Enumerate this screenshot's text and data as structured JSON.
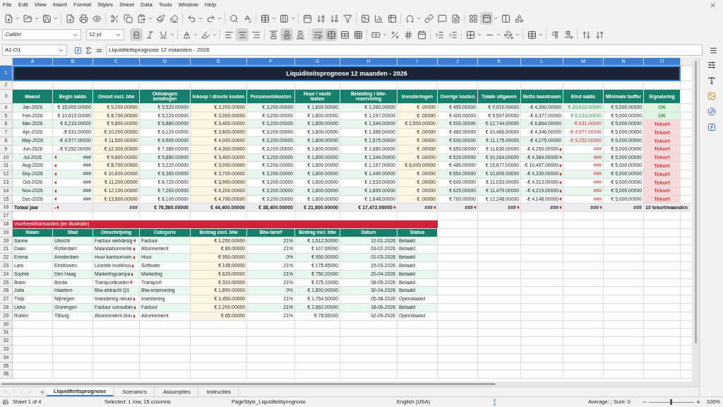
{
  "menu": [
    "File",
    "Edit",
    "View",
    "Insert",
    "Format",
    "Styles",
    "Sheet",
    "Data",
    "Tools",
    "Window",
    "Help"
  ],
  "format_toolbar": {
    "font_name": "Calibri",
    "font_size": "12 pt",
    "bold": true,
    "italic": false,
    "underline": false,
    "align_left": false,
    "align_center": true,
    "align_right": false,
    "align_top": false,
    "align_middle": true,
    "align_bottom": false,
    "wrap": true,
    "merge": true
  },
  "formula_bar": {
    "name_box": "A1:O1",
    "content": "Liquiditeitsprognose 12 maanden - 2026"
  },
  "columns": [
    {
      "label": "A",
      "selected": true
    },
    {
      "label": "B",
      "selected": true
    },
    {
      "label": "C",
      "selected": true
    },
    {
      "label": "D",
      "selected": true
    },
    {
      "label": "E",
      "selected": true
    },
    {
      "label": "F",
      "selected": true
    },
    {
      "label": "G",
      "selected": true
    },
    {
      "label": "H",
      "selected": true
    },
    {
      "label": "I",
      "selected": true
    },
    {
      "label": "J",
      "selected": true
    },
    {
      "label": "K",
      "selected": true
    },
    {
      "label": "L",
      "selected": true
    },
    {
      "label": "M",
      "selected": true
    },
    {
      "label": "N",
      "selected": true
    },
    {
      "label": "O",
      "selected": true
    }
  ],
  "rows": [
    {
      "kind": "title",
      "num": "1",
      "selected": true,
      "text": "Liquiditeitsprognose 12 maanden - 2026"
    },
    {
      "kind": "blank",
      "num": "2"
    },
    {
      "kind": "header",
      "num": "3",
      "cells": [
        "Maand",
        "Begin saldo",
        "Omzet excl. btw",
        "Ontvangen betalingen",
        "Inkoop / directe kosten",
        "Personeelskosten",
        "Huur / vaste lasten",
        "Belasting / btw-reservering",
        "Investeringen",
        "Overige kosten",
        "Totale uitgaven",
        "Netto kasstroom",
        "Eind saldo",
        "Minimale buffer",
        "Signalering"
      ]
    },
    {
      "kind": "data",
      "num": "4",
      "alert": false,
      "cells": [
        "Jan-2026",
        "€ 15,000.00000",
        "€ 9,200.00000",
        "€ 5,520.00000",
        "€ 3,200.00000",
        "€ 3,200.00000",
        "€ 1,800.00000",
        "€ 1,260.00000",
        "€ .00000",
        "€ 450.00000",
        "€ 9,910.00000",
        "-€ 4,390.00000",
        "€ 10,610.00000",
        "€ 5,000.00000",
        "OK"
      ]
    },
    {
      "kind": "data",
      "num": "5",
      "alert": false,
      "cells": [
        "Feb-2026",
        "€ 10,610.00000",
        "€ 8,700.00000",
        "€ 5,220.00000",
        "€ 3,000.00000",
        "€ 3,200.00000",
        "€ 1,800.00000",
        "€ 1,197.00000",
        "€ .00000",
        "€ 400.00000",
        "€ 9,597.00000",
        "-€ 4,377.00000",
        "€ 6,233.00000",
        "€ 5,000.00000",
        "OK"
      ]
    },
    {
      "kind": "data",
      "num": "6",
      "alert": true,
      "cells": [
        "Mar-2026",
        "€ 6,233.00000",
        "€ 9,800.00000",
        "€ 5,880.00000",
        "€ 3,400.00000",
        "€ 3,200.00000",
        "€ 1,800.00000",
        "€ 1,344.00000",
        "€ 2,500.00000",
        "€ 500.00000",
        "€ 12,744.00000",
        "-€ 6,864.00000",
        "-€ 631.00000",
        "€ 5,000.00000",
        "Tekort"
      ]
    },
    {
      "kind": "data",
      "num": "7",
      "alert": true,
      "cells": [
        "Apr-2026",
        "-€ 631.00000",
        "€ 10,200.00000",
        "€ 6,120.00000",
        "€ 3,600.00000",
        "€ 3,200.00000",
        "€ 1,800.00000",
        "€ 1,386.00000",
        "€ .00000",
        "€ 480.00000",
        "€ 10,466.00000",
        "-€ 4,346.00000",
        "-€ 4,977.00000",
        "€ 5,000.00000",
        "Tekort"
      ]
    },
    {
      "kind": "data",
      "num": "8",
      "alert": true,
      "cells": [
        "May-2026",
        "-€ 4,977.00000",
        "€ 11,500.00000",
        "€ 6,900.00000",
        "€ 4,000.00000",
        "€ 3,200.00000",
        "€ 1,800.00000",
        "€ 1,575.00000",
        "€ .00000",
        "€ 600.00000",
        "€ 11,175.00000",
        "-€ 4,275.00000",
        "-€ 9,252.00000",
        "€ 5,000.00000",
        "Tekort"
      ]
    },
    {
      "kind": "data",
      "num": "9",
      "alert": true,
      "cells": [
        "Jun-2026",
        "-€ 9,252.00000",
        "€ 12,300.00000",
        "€ 7,380.00000",
        "€ 4,300.00000",
        "€ 3,200.00000",
        "€ 1,800.00000",
        "€ 1,680.00000",
        "€ .00000",
        "€ 650.00000",
        "€ 11,630.00000",
        {
          "text": "-€ 4,250.00000",
          "clipped": true
        },
        "###",
        "€ 5,000.00000",
        "Tekort"
      ]
    },
    {
      "kind": "data",
      "num": "10",
      "alert": true,
      "cells": [
        "Jul-2026",
        {
          "text": "###",
          "clipped": true
        },
        "€ 9,800.00000",
        "€ 5,880.00000",
        "€ 3,400.00000",
        "€ 3,200.00000",
        "€ 1,800.00000",
        "€ 1,344.00000",
        "€ .00000",
        "€ 520.00000",
        "€ 10,264.00000",
        {
          "text": "-€ 4,384.00000",
          "clipped": true
        },
        "###",
        "€ 5,000.00000",
        "Tekort"
      ]
    },
    {
      "kind": "data",
      "num": "11",
      "alert": true,
      "cells": [
        "Aug-2026",
        {
          "text": "###",
          "clipped": true
        },
        "€ 8,700.00000",
        "€ 5,220.00000",
        "€ 3,000.00000",
        "€ 3,200.00000",
        "€ 1,800.00000",
        "€ 1,197.00000",
        "€ 6,000.00000",
        "€ 480.00000",
        "€ 15,677.00000",
        {
          "text": "-€ 10,457.00000",
          "clipped": true
        },
        "###",
        "€ 5,000.00000",
        "Tekort"
      ]
    },
    {
      "kind": "data",
      "num": "12",
      "alert": true,
      "cells": [
        "Sep-2026",
        {
          "text": "###",
          "clipped": true
        },
        "€ 10,600.00000",
        "€ 6,360.00000",
        "€ 3,700.00000",
        "€ 3,200.00000",
        "€ 1,800.00000",
        "€ 1,449.00000",
        "€ .00000",
        "€ 550.00000",
        "€ 10,699.00000",
        {
          "text": "-€ 4,339.00000",
          "clipped": true
        },
        "###",
        "€ 5,000.00000",
        "Tekort"
      ]
    },
    {
      "kind": "data",
      "num": "13",
      "alert": true,
      "cells": [
        "Oct-2026",
        {
          "text": "###",
          "clipped": true
        },
        "€ 11,200.00000",
        "€ 6,720.00000",
        "€ 3,900.00000",
        "€ 3,200.00000",
        "€ 1,800.00000",
        "€ 1,533.00000",
        "€ .00000",
        "€ 600.00000",
        "€ 11,033.00000",
        {
          "text": "-€ 4,313.00000",
          "clipped": true
        },
        "###",
        "€ 5,000.00000",
        "Tekort"
      ]
    },
    {
      "kind": "data",
      "num": "14",
      "alert": true,
      "cells": [
        "Nov-2026",
        {
          "text": "###",
          "clipped": true
        },
        "€ 12,100.00000",
        "€ 7,260.00000",
        "€ 4,200.00000",
        "€ 3,200.00000",
        "€ 1,800.00000",
        "€ 1,659.00000",
        "€ .00000",
        "€ 620.00000",
        "€ 11,479.00000",
        {
          "text": "-€ 4,219.00000",
          "clipped": true
        },
        "###",
        "€ 5,000.00000",
        "Tekort"
      ]
    },
    {
      "kind": "data",
      "num": "15",
      "alert": true,
      "cells": [
        "Dec-2026",
        {
          "text": "###",
          "clipped": true
        },
        "€ 13,500.00000",
        "€ 8,100.00000",
        "€ 4,700.00000",
        "€ 3,200.00000",
        "€ 1,800.00000",
        "€ 1,848.00000",
        "€ .00000",
        "€ 700.00000",
        "€ 12,248.00000",
        {
          "text": "-€ 4,148.00000",
          "clipped": true
        },
        "###",
        "€ 5,000.00000",
        "Tekort"
      ]
    },
    {
      "kind": "total",
      "num": "16",
      "cells": [
        "Totaal jaar",
        {
          "text": "-",
          "clipped": true
        },
        "###",
        "€ 76,560.00000",
        "€ 44,400.00000",
        "€ 38,400.00000",
        "€ 21,600.00000",
        {
          "text": "€ 17,472.00000",
          "clipped": true
        },
        {
          "text": "###",
          "clipped": true
        },
        {
          "text": "###",
          "clipped": true
        },
        {
          "text": "###",
          "clipped": true
        },
        {
          "text": "###",
          "clipped": true
        },
        {
          "text": "###",
          "clipped": true
        },
        "###",
        "10 tekortmaanden"
      ]
    },
    {
      "kind": "blank",
      "num": "17"
    },
    {
      "kind": "banner",
      "num": "18",
      "text": "Voorbeeldtransacties (ter illustratie)"
    },
    {
      "kind": "tx_header",
      "num": "19",
      "cells": [
        "Naam",
        "Stad",
        "Omschrijving",
        "Categorie",
        "Bedrag excl. btw",
        "Btw-tarief",
        "Bedrag incl. btw",
        "Datum",
        "Status"
      ]
    },
    {
      "kind": "tx",
      "num": "20",
      "cells": [
        "Sanne",
        "Utrecht",
        {
          "text": "Factuur webdesig",
          "clipped": true
        },
        "Factuur",
        "€ 1,250.00000",
        "21%",
        "€ 1,512.50000",
        "12-01-2026",
        "Betaald"
      ]
    },
    {
      "kind": "tx",
      "num": "21",
      "cells": [
        "Daan",
        "Rotterdam",
        {
          "text": "Maandabonneme",
          "clipped": true
        },
        "Abonnement",
        "€ 89.00000",
        "21%",
        "€ 107.69000",
        "03-02-2026",
        "Betaald"
      ]
    },
    {
      "kind": "tx",
      "num": "22",
      "cells": [
        "Emma",
        "Amsterdam",
        {
          "text": "Huur kantoorruim",
          "clipped": true
        },
        "Huur",
        "€ 950.00000",
        "0%",
        "€ 950.00000",
        "01-03-2026",
        "Betaald"
      ]
    },
    {
      "kind": "tx",
      "num": "23",
      "cells": [
        "Lars",
        "Eindhoven",
        {
          "text": "Licentie boekhou",
          "clipped": true
        },
        "Software",
        "€ 145.00000",
        "21%",
        "€ 175.45000",
        "15-03-2026",
        "Betaald"
      ]
    },
    {
      "kind": "tx",
      "num": "24",
      "cells": [
        "Sophie",
        "Den Haag",
        {
          "text": "Marketingcampa",
          "clipped": true
        },
        "Marketing",
        "€ 620.00000",
        "21%",
        "€ 750.20000",
        "20-04-2026",
        "Betaald"
      ]
    },
    {
      "kind": "tx",
      "num": "25",
      "cells": [
        "Bram",
        "Breda",
        {
          "text": "Transportkosten",
          "clipped": true
        },
        "Transport",
        "€ 310.00000",
        "21%",
        "€ 375.10000",
        "08-05-2026",
        "Betaald"
      ]
    },
    {
      "kind": "tx",
      "num": "26",
      "cells": [
        "Julia",
        "Haarlem",
        "Btw-afdracht Q1",
        "Btw-reservering",
        "€ 1,890.00000",
        "0%",
        "€ 1,890.00000",
        "30-04-2026",
        "Betaald"
      ]
    },
    {
      "kind": "tx",
      "num": "27",
      "cells": [
        "Thijs",
        "Nijmegen",
        {
          "text": "Investering nieuw",
          "clipped": true
        },
        "Investering",
        "€ 1,450.00000",
        "21%",
        "€ 1,754.50000",
        "05-08-2026",
        "Openstaand"
      ]
    },
    {
      "kind": "tx",
      "num": "28",
      "cells": [
        "Lieke",
        "Groningen",
        {
          "text": "Factuur consultan",
          "clipped": true
        },
        "Factuur",
        "€ 2,200.00000",
        "21%",
        "€ 2,662.00000",
        "18-06-2026",
        "Betaald"
      ]
    },
    {
      "kind": "tx",
      "num": "29",
      "cells": [
        "Ruben",
        "Tilburg",
        {
          "text": "Abonnement clou",
          "clipped": true
        },
        "Abonnement",
        "€ 65.00000",
        "21%",
        "€ 78.65000",
        "02-09-2026",
        "Openstaand"
      ]
    },
    {
      "kind": "blank",
      "num": "30"
    },
    {
      "kind": "blank",
      "num": "31"
    },
    {
      "kind": "blank",
      "num": "32"
    },
    {
      "kind": "blank",
      "num": "33"
    },
    {
      "kind": "blank",
      "num": "34"
    },
    {
      "kind": "blank",
      "num": "35"
    },
    {
      "kind": "blank",
      "num": "36"
    }
  ],
  "sheet_tabs": [
    {
      "label": "Liquiditeitsprognose",
      "selected": true
    },
    {
      "label": "Scenario's",
      "selected": false
    },
    {
      "label": "Assumpties",
      "selected": false
    },
    {
      "label": "Instructies",
      "selected": false
    }
  ],
  "status_bar": {
    "sheet": "Sheet 1 of 4",
    "selection": "Selected: 1 row, 15 columns",
    "page_style": "PageStyle_Liquiditeitsprognose",
    "language": "English (USA)",
    "summary": "Average: ; Sum: 0",
    "zoom": {
      "level": 0.5,
      "label": "100%"
    }
  }
}
